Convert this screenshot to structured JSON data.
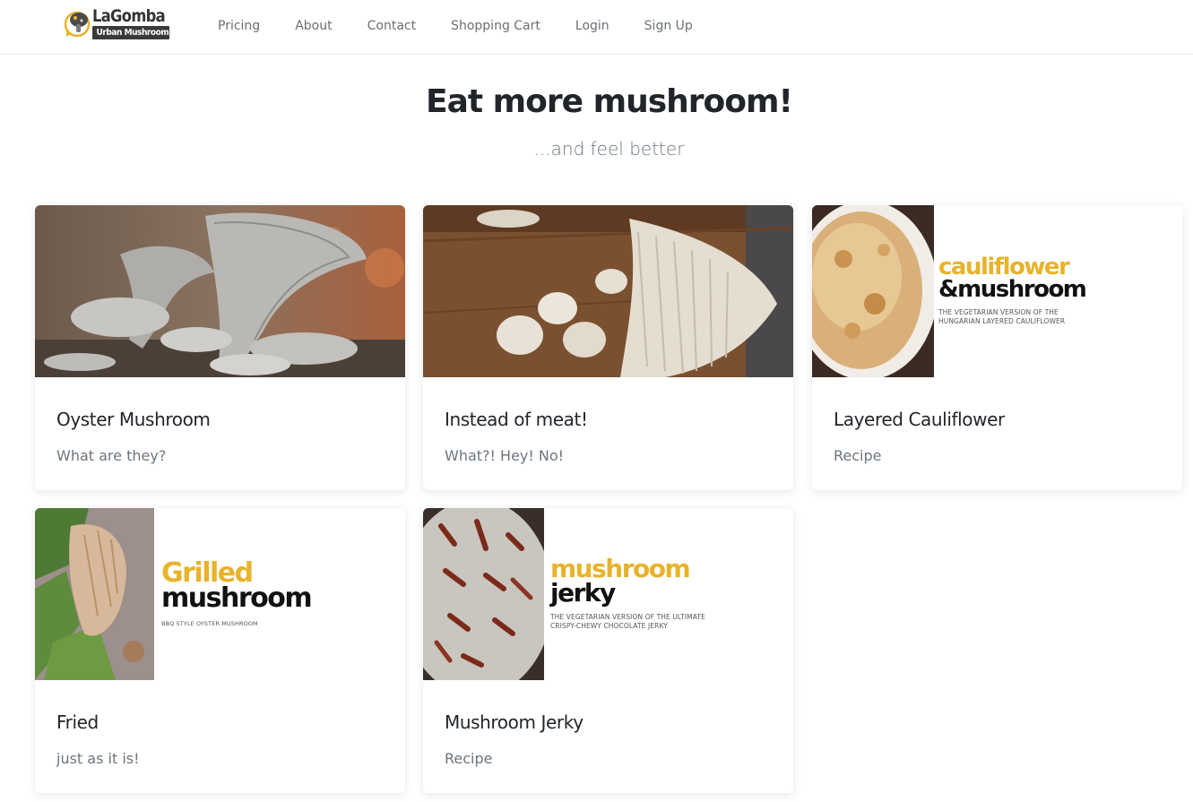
{
  "brand": {
    "name_top": "LaGomba",
    "name_bottom": "Urban Mushroom",
    "accent_color": "#e8b32a"
  },
  "nav": {
    "items": [
      {
        "label": "Pricing"
      },
      {
        "label": "About"
      },
      {
        "label": "Contact"
      },
      {
        "label": "Shopping Cart"
      },
      {
        "label": "Login"
      },
      {
        "label": "Sign Up"
      }
    ]
  },
  "hero": {
    "title": "Eat more mushroom!",
    "subtitle": "...and feel better"
  },
  "cards": [
    {
      "title": "Oyster Mushroom",
      "subtitle": "What are they?",
      "image": "oyster-mushroom-photo"
    },
    {
      "title": "Instead of meat!",
      "subtitle": "What?! Hey! No!",
      "image": "sliced-mushroom-cutting-board-photo"
    },
    {
      "title": "Layered Cauliflower",
      "subtitle": "Recipe",
      "image": "cauliflower-casserole-graphic",
      "graphic": {
        "line1": "cauliflower",
        "line2": "&mushroom",
        "caption1": "THE VEGETARIAN VERSION OF THE",
        "caption2": "HUNGARIAN LAYERED CAULIFLOWER"
      }
    },
    {
      "title": "Fried",
      "subtitle": "just as it is!",
      "image": "grilled-mushroom-salad-graphic",
      "graphic": {
        "line1": "Grilled",
        "line2": "mushroom",
        "caption1": "BBQ STYLE OYSTER MUSHROOM"
      }
    },
    {
      "title": "Mushroom Jerky",
      "subtitle": "Recipe",
      "image": "mushroom-jerky-graphic",
      "graphic": {
        "line1": "mushroom",
        "line2": "jerky",
        "caption1": "THE VEGETARIAN VERSION OF THE ULTIMATE",
        "caption2": "CRISPY-CHEWY CHOCOLATE JERKY"
      }
    }
  ]
}
